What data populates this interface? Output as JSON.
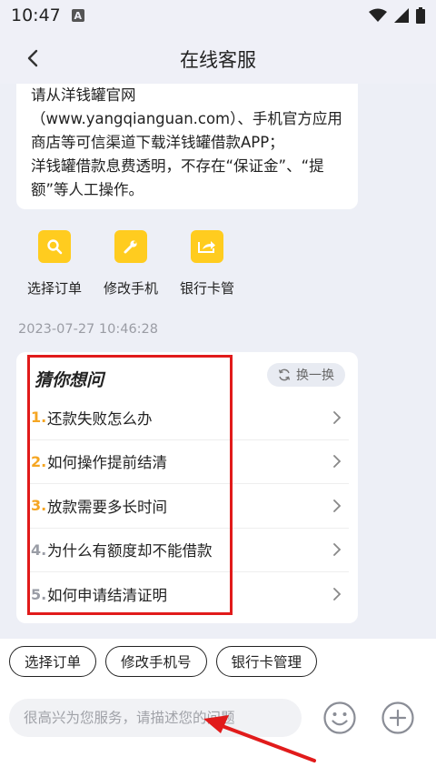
{
  "status": {
    "time": "10:47",
    "indicator": "A"
  },
  "header": {
    "title": "在线客服",
    "back_icon": "chevron-left-icon"
  },
  "message": {
    "lines": [
      "请从洋钱罐官网",
      "（www.yangqianguan.com）、手机官方应用",
      "商店等可信渠道下载洋钱罐借款APP；",
      "洋钱罐借款息费透明，不存在“保证金”、“提",
      "额”等人工操作。"
    ]
  },
  "quick_actions": [
    {
      "label": "选择订单",
      "icon": "magnifier-icon"
    },
    {
      "label": "修改手机",
      "icon": "wrench-icon"
    },
    {
      "label": "银行卡管",
      "icon": "share-arrow-icon"
    }
  ],
  "timestamp": "2023-07-27 10:46:28",
  "faq": {
    "title": "猜你想问",
    "refresh_label": "换一换",
    "items": [
      {
        "num": "1.",
        "text": "还款失败怎么办",
        "num_color": "#f5a623"
      },
      {
        "num": "2.",
        "text": "如何操作提前结清",
        "num_color": "#f5a623"
      },
      {
        "num": "3.",
        "text": "放款需要多长时间",
        "num_color": "#f5a623"
      },
      {
        "num": "4.",
        "text": "为什么有额度却不能借款",
        "num_color": "#9a9da6"
      },
      {
        "num": "5.",
        "text": "如何申请结清证明",
        "num_color": "#9a9da6"
      }
    ]
  },
  "chips": [
    "选择订单",
    "修改手机号",
    "银行卡管理"
  ],
  "input": {
    "placeholder": "很高兴为您服务，请描述您的问题"
  },
  "colors": {
    "accent_yellow": "#ffcc1f",
    "annotation_red": "#e11b1b",
    "background": "#edeff6"
  }
}
